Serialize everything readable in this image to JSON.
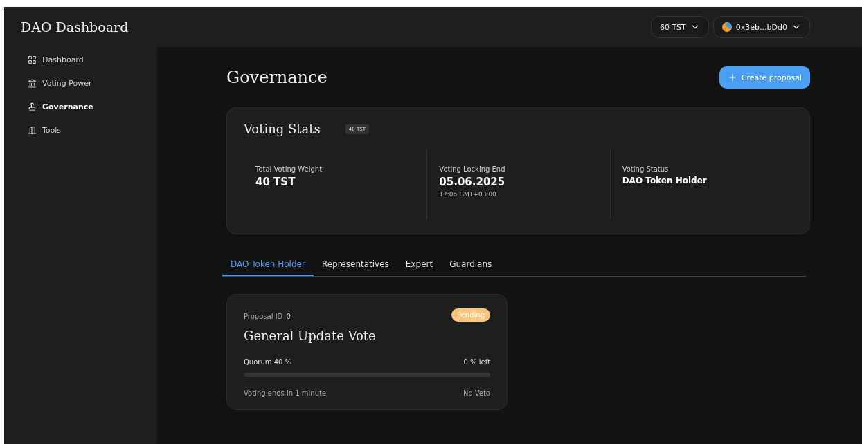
{
  "sidebar": {
    "title": "DAO Dashboard",
    "items": [
      {
        "label": "Dashboard",
        "selected": false
      },
      {
        "label": "Voting Power",
        "selected": false
      },
      {
        "label": "Governance",
        "selected": true
      },
      {
        "label": "Tools",
        "selected": false
      }
    ]
  },
  "header": {
    "balance": "60 TST",
    "wallet": "0x3eb...bDd0"
  },
  "page": {
    "title": "Governance",
    "create_button": "Create proposal"
  },
  "voting_stats": {
    "title": "Voting Stats",
    "badge": "40 TST",
    "stats": [
      {
        "label": "Total Voting Weight",
        "value": "40 TST",
        "kind": "plain"
      },
      {
        "label": "Voting Locking End",
        "value": "05.06.2025",
        "sub": "17:06 GMT+03:00",
        "kind": "dated"
      },
      {
        "label": "Voting Status",
        "value": "DAO Token Holder",
        "kind": "status"
      }
    ]
  },
  "tabs": [
    {
      "label": "DAO Token Holder",
      "selected": true
    },
    {
      "label": "Representatives",
      "selected": false
    },
    {
      "label": "Expert",
      "selected": false
    },
    {
      "label": "Guardians",
      "selected": false
    }
  ],
  "proposals": [
    {
      "id_label": "Proposal ID",
      "id": "0",
      "status": "Pending",
      "color": "#fdc57c",
      "title": "General Update Vote",
      "quorum": "Quorum 40 %",
      "left": "0 % left",
      "level": 0,
      "ends": "Voting ends in 1 minute",
      "veto": "No Veto"
    }
  ]
}
